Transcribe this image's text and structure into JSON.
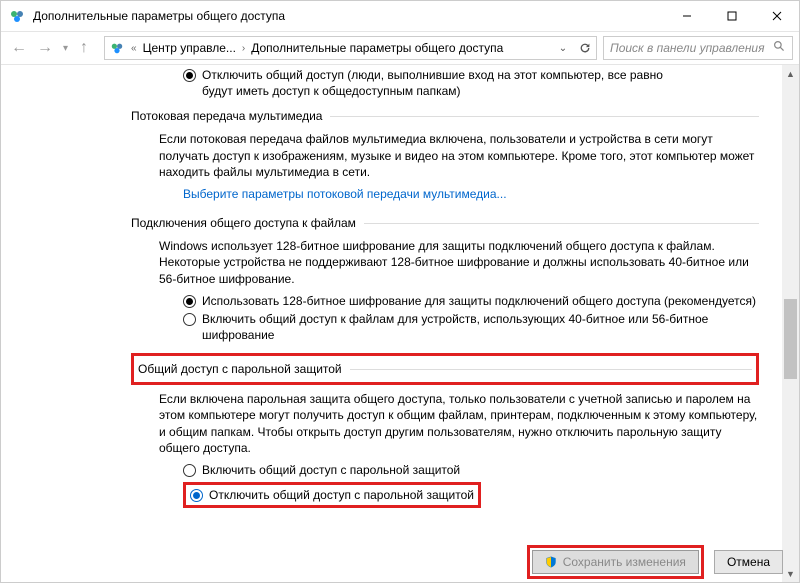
{
  "window": {
    "title": "Дополнительные параметры общего доступа"
  },
  "breadcrumb": {
    "seg1": "Центр управле...",
    "seg2": "Дополнительные параметры общего доступа"
  },
  "search": {
    "placeholder": "Поиск в панели управления"
  },
  "section1": {
    "radio1_line1": "Отключить общий доступ (люди, выполнившие вход на этот компьютер, все равно",
    "radio1_line2": "будут иметь доступ к общедоступным папкам)"
  },
  "section2": {
    "header": "Потоковая передача мультимедиа",
    "para": "Если потоковая передача файлов мультимедиа включена, пользователи и устройства в сети могут получать доступ к изображениям, музыке и видео на этом компьютере. Кроме того, этот компьютер может находить файлы мультимедиа в сети.",
    "link": "Выберите параметры потоковой передачи мультимедиа..."
  },
  "section3": {
    "header": "Подключения общего доступа к файлам",
    "para": "Windows использует 128-битное шифрование для защиты подключений общего доступа к файлам. Некоторые устройства не поддерживают 128-битное шифрование и должны использовать 40-битное или 56-битное шифрование.",
    "radio1": "Использовать 128-битное шифрование для защиты подключений общего доступа (рекомендуется)",
    "radio2": "Включить общий доступ к файлам для устройств, использующих 40-битное или 56-битное шифрование"
  },
  "section4": {
    "header": "Общий доступ с парольной защитой",
    "para": "Если включена парольная защита общего доступа, только пользователи с учетной записью и паролем на этом компьютере могут получить доступ к общим файлам, принтерам, подключенным к этому компьютеру, и общим папкам. Чтобы открыть доступ другим пользователям, нужно отключить парольную защиту общего доступа.",
    "radio1": "Включить общий доступ с парольной защитой",
    "radio2": "Отключить общий доступ с парольной защитой"
  },
  "buttons": {
    "save": "Сохранить изменения",
    "cancel": "Отмена"
  }
}
